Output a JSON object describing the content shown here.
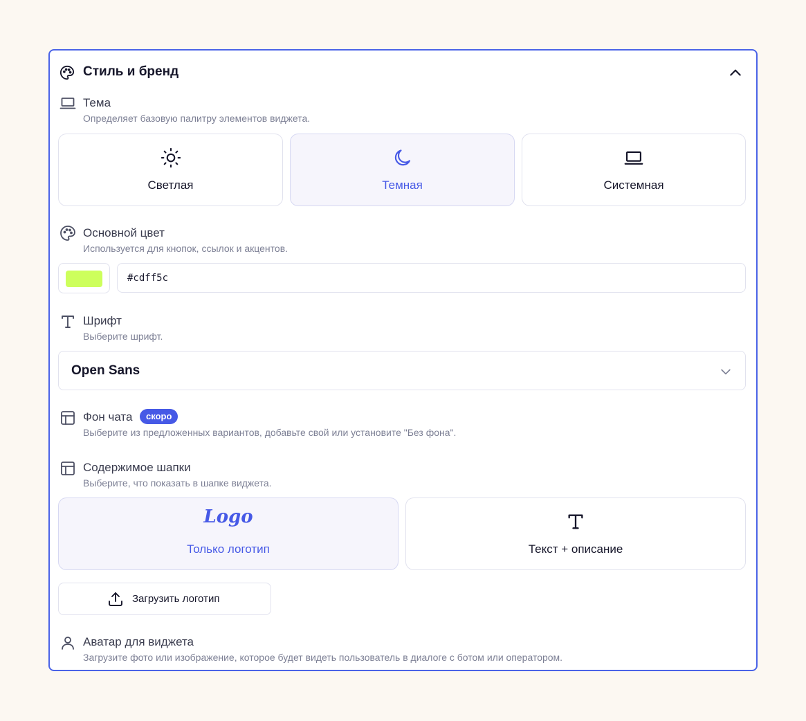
{
  "panel": {
    "title": "Стиль и бренд",
    "icon": "palette-icon",
    "collapse_icon": "chevron-up-icon"
  },
  "theme": {
    "title": "Тема",
    "description": "Определяет базовую палитру элементов виджета.",
    "icon": "laptop-icon",
    "options": [
      {
        "label": "Светлая",
        "icon": "sun-icon",
        "selected": false
      },
      {
        "label": "Темная",
        "icon": "moon-icon",
        "selected": true
      },
      {
        "label": "Системная",
        "icon": "laptop-icon",
        "selected": false
      }
    ]
  },
  "primary_color": {
    "title": "Основной цвет",
    "description": "Используется для кнопок, ссылок и акцентов.",
    "icon": "palette-icon",
    "value": "#cdff5c"
  },
  "font": {
    "title": "Шрифт",
    "description": "Выберите шрифт.",
    "icon": "type-icon",
    "selected": "Open Sans",
    "chevron_icon": "chevron-down-icon"
  },
  "chat_background": {
    "title": "Фон чата",
    "badge": "скоро",
    "description": "Выберите из предложенных вариантов, добавьте свой или установите \"Без фона\".",
    "icon": "layout-icon"
  },
  "header_content": {
    "title": "Содержимое шапки",
    "description": "Выберите, что показать в шапке виджета.",
    "icon": "layout-icon",
    "options": [
      {
        "label": "Только логотип",
        "icon": "logo-icon",
        "icon_text": "Logo",
        "selected": true
      },
      {
        "label": "Текст + описание",
        "icon": "type-icon",
        "selected": false
      }
    ],
    "upload_label": "Загрузить логотип",
    "upload_icon": "upload-icon"
  },
  "avatar": {
    "title": "Аватар для виджета",
    "description": "Загрузите фото или изображение, которое будет видеть пользователь в диалоге с ботом или оператором.",
    "icon": "user-icon"
  },
  "colors": {
    "accent": "#4659e6",
    "border_focus": "#4a63e7",
    "swatch": "#cdff5c"
  }
}
